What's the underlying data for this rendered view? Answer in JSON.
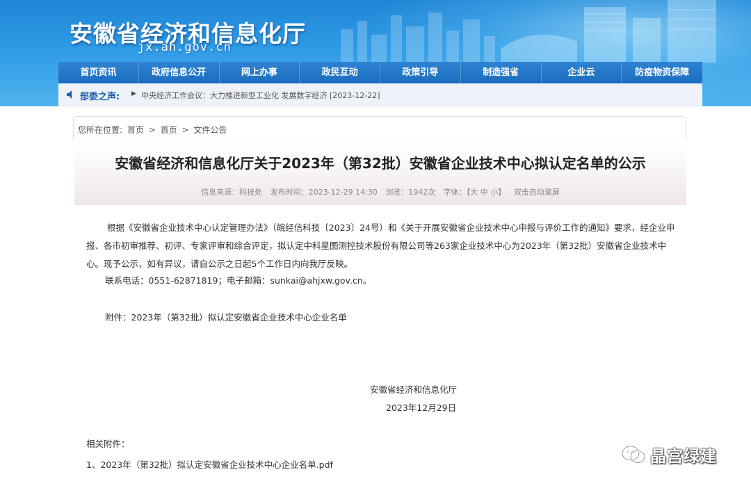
{
  "header": {
    "site_title": "安徽省经济和信息化厅",
    "site_domain": "jx.ah.gov.cn"
  },
  "nav": {
    "items": [
      "首页资讯",
      "政府信息公开",
      "网上办事",
      "政民互动",
      "政策引导",
      "制造强省",
      "企业云",
      "防疫物资保障"
    ]
  },
  "voice": {
    "label": "部委之声:",
    "news": "中央经济工作会议：大力推进新型工业化 发展数字经济 [2023-12-22]"
  },
  "breadcrumb": {
    "prefix": "您所在位置:",
    "items": [
      "首页",
      ">",
      "首页",
      ">",
      "文件公告"
    ]
  },
  "article": {
    "title": "安徽省经济和信息化厅关于2023年（第32批）安徽省企业技术中心拟认定名单的公示",
    "meta": {
      "source": "信息来源：科技处",
      "time": "发布时间：2023-12-29 14:30",
      "views": "浏览：1942次",
      "font_label": "字体：",
      "font_sizes": "【大 中 小】",
      "autoscroll": "双击自动滚屏"
    },
    "paragraph": "根据《安徽省企业技术中心认定管理办法》（皖经信科技〔2023〕24号）和《关于开展安徽省企业技术中心申报与评价工作的通知》要求，经企业申报、各市初审推荐、初评、专家评审和综合评定，拟认定中科星图测控技术股份有限公司等263家企业技术中心为2023年（第32批）安徽省企业技术中心。现予公示，如有异议，请自公示之日起5个工作日内向我厅反映。",
    "contact": "联系电话：0551-62871819；电子邮箱：sunkai@ahjxw.gov.cn。",
    "attachment_note": "附件：2023年（第32批）拟认定安徽省企业技术中心企业名单",
    "sign_org": "安徽省经济和信息化厅",
    "sign_date": "2023年12月29日",
    "related_label": "相关附件：",
    "related_file": "1、2023年（第32批）拟认定安徽省企业技术中心企业名单.pdf"
  },
  "watermark": {
    "text": "晶宫绿建",
    "icon": "wechat-icon"
  }
}
